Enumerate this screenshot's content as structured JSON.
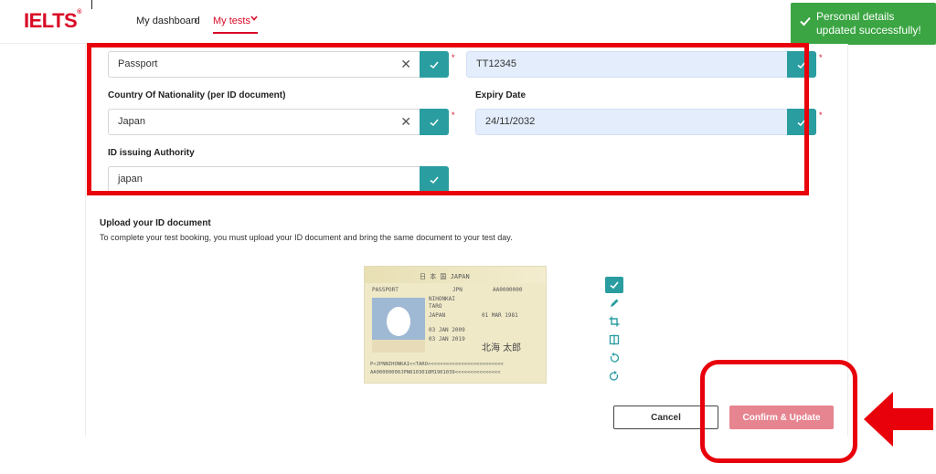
{
  "header": {
    "logo": "IELTS",
    "nav": {
      "dashboard": "My dashboard",
      "separator": "›",
      "my_tests": "My tests"
    }
  },
  "toast": {
    "message": "Personal details updated successfully!",
    "icon": "check-icon",
    "color": "#3aa542"
  },
  "form": {
    "id_type": {
      "value": "Passport",
      "required": "*"
    },
    "id_number": {
      "value": "TT12345",
      "required": "*"
    },
    "nationality": {
      "label": "Country Of Nationality (per ID document)",
      "value": "Japan",
      "required": "*"
    },
    "expiry": {
      "label": "Expiry Date",
      "value": "24/11/2032",
      "required": "*"
    },
    "authority": {
      "label": "ID issuing Authority",
      "value": "japan"
    }
  },
  "upload": {
    "title": "Upload your ID document",
    "description": "To complete your test booking, you must upload your ID document and bring the same document to your test day.",
    "passport": {
      "header": "日 本 国 JAPAN",
      "type": "PASSPORT",
      "code": "JPN",
      "number": "AA0000000",
      "surname": "NIHONKAI",
      "given": "TARO",
      "nationality": "JAPAN",
      "dob": "01 MAR 1981",
      "issue": "03 JAN 2009",
      "expiry": "03 JAN 2019",
      "signature": "北海 太郎",
      "mrz1": "P<JPNNIHONKAI<<TARO<<<<<<<<<<<<<<<<<<<<<<<<<",
      "mrz2": "AA00000000JPN8103018M1901039<<<<<<<<<<<<<<<"
    },
    "tools": [
      "check-icon",
      "pencil-icon",
      "crop-icon",
      "flip-icon",
      "rotate-left-icon",
      "rotate-right-icon"
    ]
  },
  "actions": {
    "cancel": "Cancel",
    "confirm": "Confirm & Update"
  },
  "colors": {
    "brand": "#d80a26",
    "teal": "#2a9da1",
    "annotation": "#e8000b",
    "confirm_bg": "#e6848f"
  }
}
